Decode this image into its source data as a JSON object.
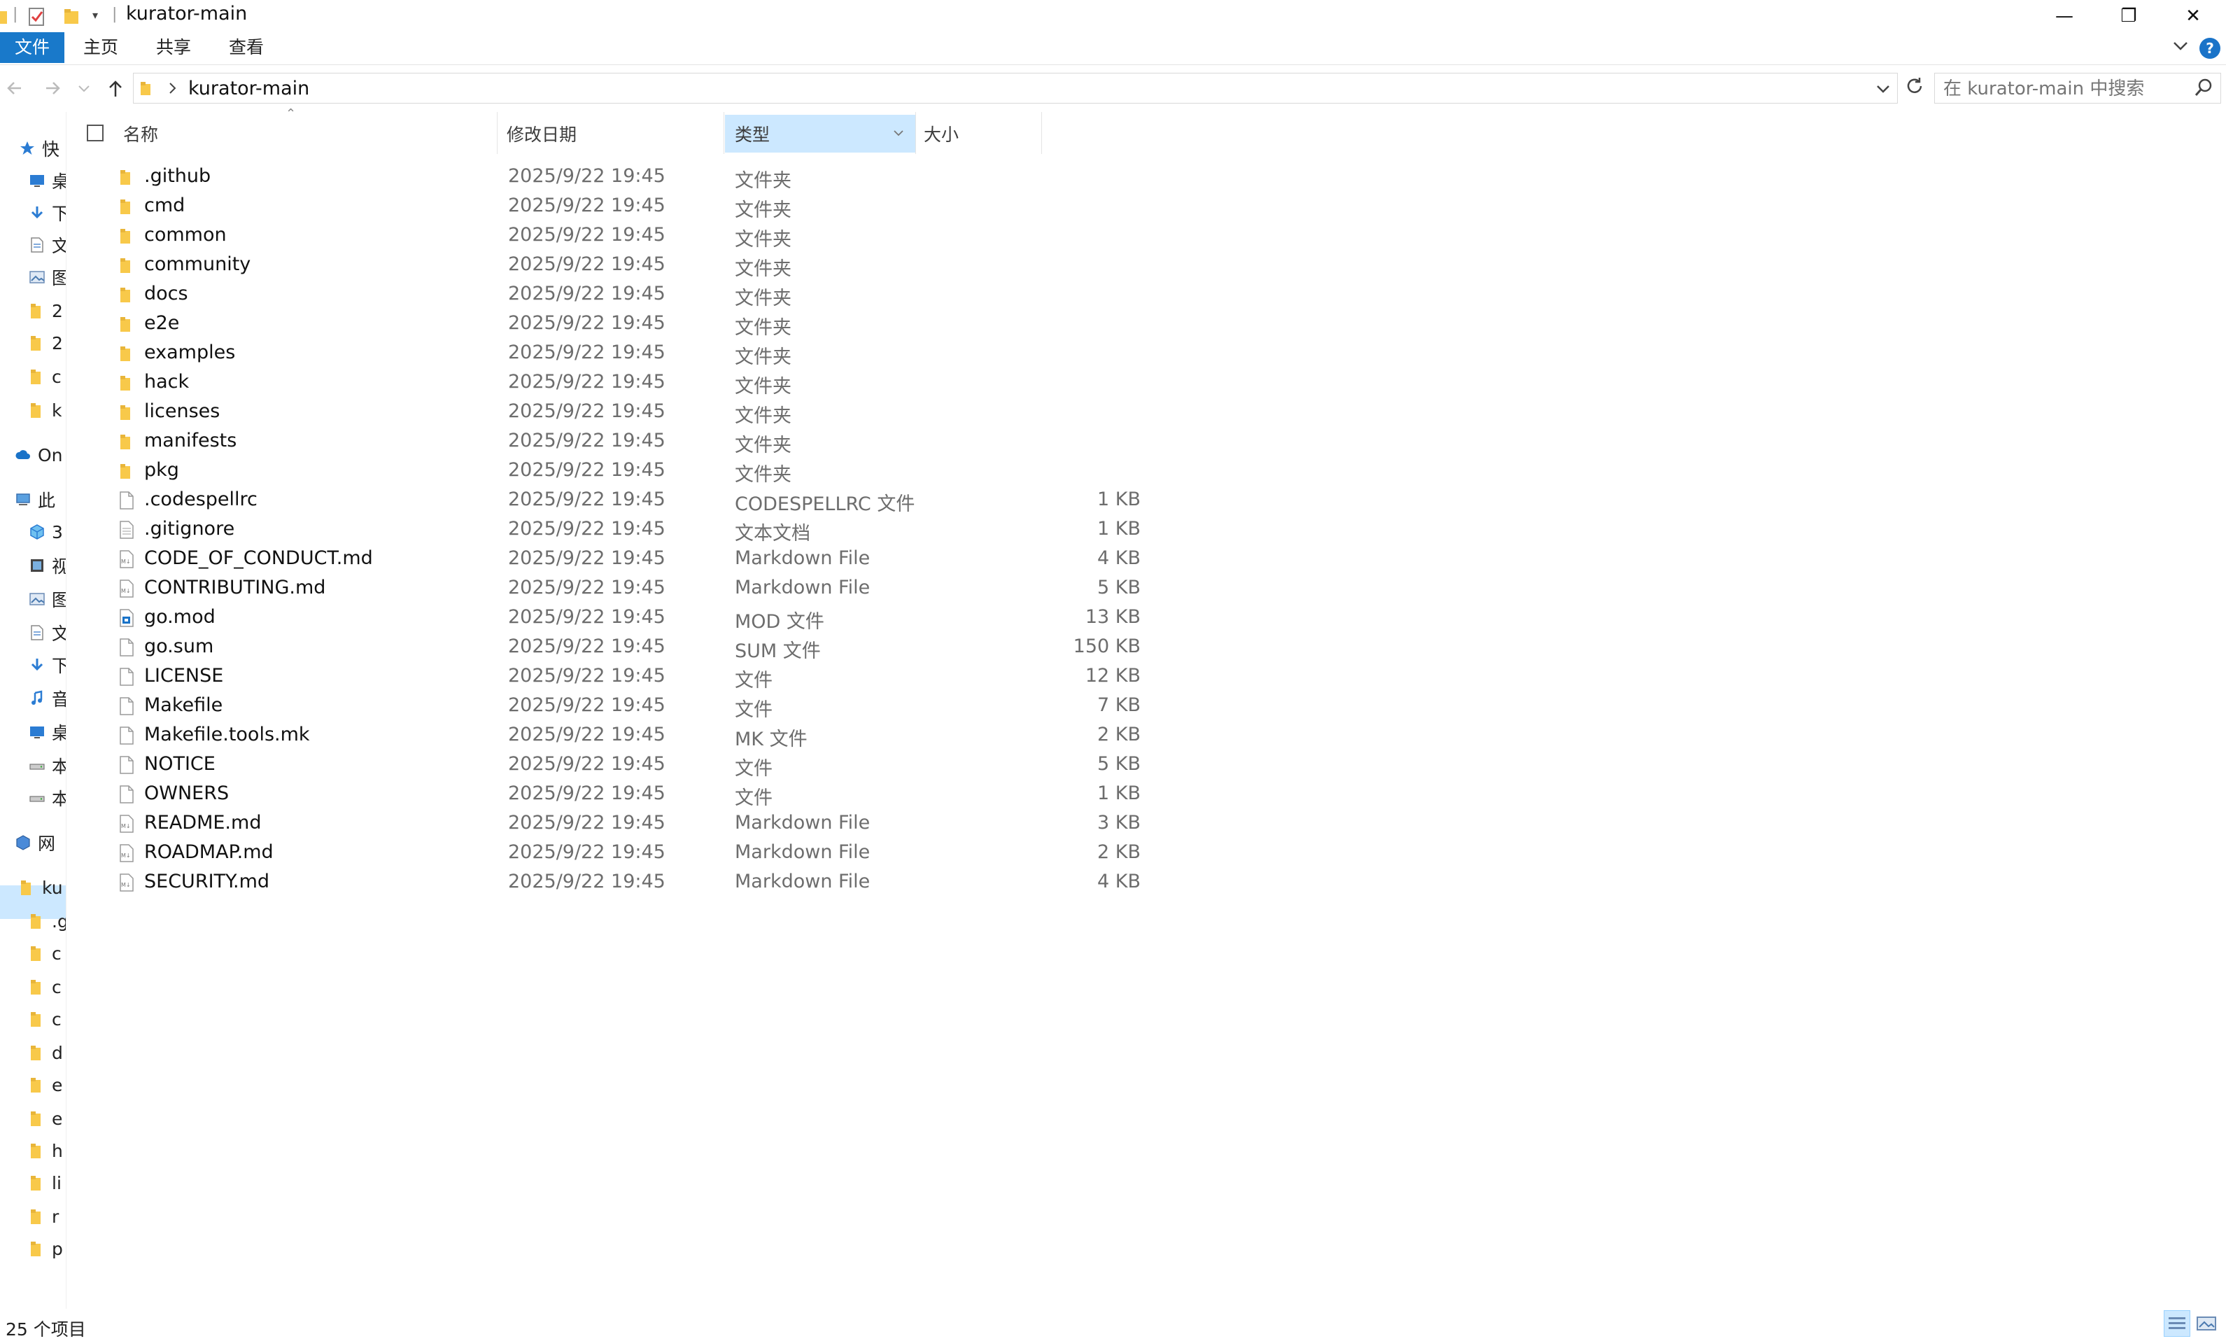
{
  "window": {
    "title": "kurator-main",
    "controls": {
      "minimize": "—",
      "maximize": "❐",
      "close": "✕"
    }
  },
  "ribbon": {
    "tabs": [
      {
        "label": "文件"
      },
      {
        "label": "主页"
      },
      {
        "label": "共享"
      },
      {
        "label": "查看"
      }
    ],
    "help": "?"
  },
  "address": {
    "crumb": "kurator-main",
    "search_placeholder": "在 kurator-main 中搜索"
  },
  "columns": {
    "name": "名称",
    "modified": "修改日期",
    "type": "类型",
    "size": "大小"
  },
  "nav_pane": {
    "items": [
      {
        "label": "快",
        "icon": "star-icon"
      },
      {
        "label": "桌",
        "icon": "desktop-icon"
      },
      {
        "label": "下",
        "icon": "download-icon"
      },
      {
        "label": "文",
        "icon": "document-icon"
      },
      {
        "label": "图",
        "icon": "picture-icon"
      },
      {
        "label": "2",
        "icon": "folder-icon"
      },
      {
        "label": "2",
        "icon": "folder-icon"
      },
      {
        "label": "c",
        "icon": "folder-icon"
      },
      {
        "label": "k",
        "icon": "folder-icon"
      },
      {
        "label": "On",
        "icon": "cloud-icon"
      },
      {
        "label": "此",
        "icon": "computer-icon"
      },
      {
        "label": "3",
        "icon": "3d-objects-icon"
      },
      {
        "label": "视",
        "icon": "video-icon"
      },
      {
        "label": "图",
        "icon": "picture-icon"
      },
      {
        "label": "文",
        "icon": "document-icon"
      },
      {
        "label": "下",
        "icon": "download-icon"
      },
      {
        "label": "音",
        "icon": "music-icon"
      },
      {
        "label": "桌",
        "icon": "desktop-icon"
      },
      {
        "label": "本",
        "icon": "drive-icon"
      },
      {
        "label": "本",
        "icon": "drive-icon"
      },
      {
        "label": "网",
        "icon": "network-icon"
      },
      {
        "label": "ku",
        "icon": "folder-icon"
      },
      {
        "label": ".g",
        "icon": "folder-icon"
      },
      {
        "label": "c",
        "icon": "folder-icon"
      },
      {
        "label": "c",
        "icon": "folder-icon"
      },
      {
        "label": "c",
        "icon": "folder-icon"
      },
      {
        "label": "d",
        "icon": "folder-icon"
      },
      {
        "label": "e",
        "icon": "folder-icon"
      },
      {
        "label": "e",
        "icon": "folder-icon"
      },
      {
        "label": "h",
        "icon": "folder-icon"
      },
      {
        "label": "li",
        "icon": "folder-icon"
      },
      {
        "label": "r",
        "icon": "folder-icon"
      },
      {
        "label": "p",
        "icon": "folder-icon"
      }
    ]
  },
  "files": [
    {
      "name": ".github",
      "date": "2025/9/22 19:45",
      "type": "文件夹",
      "size": "",
      "icon": "folder-icon"
    },
    {
      "name": "cmd",
      "date": "2025/9/22 19:45",
      "type": "文件夹",
      "size": "",
      "icon": "folder-icon"
    },
    {
      "name": "common",
      "date": "2025/9/22 19:45",
      "type": "文件夹",
      "size": "",
      "icon": "folder-icon"
    },
    {
      "name": "community",
      "date": "2025/9/22 19:45",
      "type": "文件夹",
      "size": "",
      "icon": "folder-icon"
    },
    {
      "name": "docs",
      "date": "2025/9/22 19:45",
      "type": "文件夹",
      "size": "",
      "icon": "folder-icon"
    },
    {
      "name": "e2e",
      "date": "2025/9/22 19:45",
      "type": "文件夹",
      "size": "",
      "icon": "folder-icon"
    },
    {
      "name": "examples",
      "date": "2025/9/22 19:45",
      "type": "文件夹",
      "size": "",
      "icon": "folder-icon"
    },
    {
      "name": "hack",
      "date": "2025/9/22 19:45",
      "type": "文件夹",
      "size": "",
      "icon": "folder-icon"
    },
    {
      "name": "licenses",
      "date": "2025/9/22 19:45",
      "type": "文件夹",
      "size": "",
      "icon": "folder-icon"
    },
    {
      "name": "manifests",
      "date": "2025/9/22 19:45",
      "type": "文件夹",
      "size": "",
      "icon": "folder-icon"
    },
    {
      "name": "pkg",
      "date": "2025/9/22 19:45",
      "type": "文件夹",
      "size": "",
      "icon": "folder-icon"
    },
    {
      "name": ".codespellrc",
      "date": "2025/9/22 19:45",
      "type": "CODESPELLRC 文件",
      "size": "1 KB",
      "icon": "file-icon"
    },
    {
      "name": ".gitignore",
      "date": "2025/9/22 19:45",
      "type": "文本文档",
      "size": "1 KB",
      "icon": "text-file-icon"
    },
    {
      "name": "CODE_OF_CONDUCT.md",
      "date": "2025/9/22 19:45",
      "type": "Markdown File",
      "size": "4 KB",
      "icon": "markdown-file-icon"
    },
    {
      "name": "CONTRIBUTING.md",
      "date": "2025/9/22 19:45",
      "type": "Markdown File",
      "size": "5 KB",
      "icon": "markdown-file-icon"
    },
    {
      "name": "go.mod",
      "date": "2025/9/22 19:45",
      "type": "MOD 文件",
      "size": "13 KB",
      "icon": "mod-file-icon"
    },
    {
      "name": "go.sum",
      "date": "2025/9/22 19:45",
      "type": "SUM 文件",
      "size": "150 KB",
      "icon": "file-icon"
    },
    {
      "name": "LICENSE",
      "date": "2025/9/22 19:45",
      "type": "文件",
      "size": "12 KB",
      "icon": "file-icon"
    },
    {
      "name": "Makefile",
      "date": "2025/9/22 19:45",
      "type": "文件",
      "size": "7 KB",
      "icon": "file-icon"
    },
    {
      "name": "Makefile.tools.mk",
      "date": "2025/9/22 19:45",
      "type": "MK 文件",
      "size": "2 KB",
      "icon": "file-icon"
    },
    {
      "name": "NOTICE",
      "date": "2025/9/22 19:45",
      "type": "文件",
      "size": "5 KB",
      "icon": "file-icon"
    },
    {
      "name": "OWNERS",
      "date": "2025/9/22 19:45",
      "type": "文件",
      "size": "1 KB",
      "icon": "file-icon"
    },
    {
      "name": "README.md",
      "date": "2025/9/22 19:45",
      "type": "Markdown File",
      "size": "3 KB",
      "icon": "markdown-file-icon"
    },
    {
      "name": "ROADMAP.md",
      "date": "2025/9/22 19:45",
      "type": "Markdown File",
      "size": "2 KB",
      "icon": "markdown-file-icon"
    },
    {
      "name": "SECURITY.md",
      "date": "2025/9/22 19:45",
      "type": "Markdown File",
      "size": "4 KB",
      "icon": "markdown-file-icon"
    }
  ],
  "status": {
    "count": "25 个项目"
  },
  "colors": {
    "accent": "#1979ca",
    "selection": "#cce8ff",
    "folder": "#f8c94a",
    "muted_text": "#6d6d6d"
  }
}
